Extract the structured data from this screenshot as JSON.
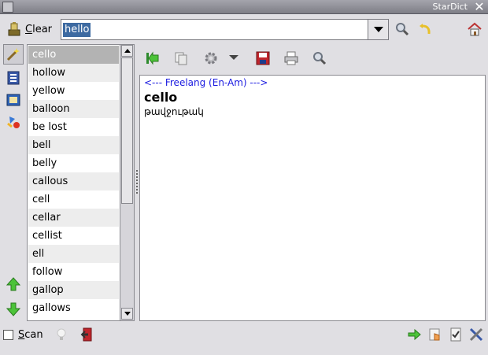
{
  "window": {
    "title": "StarDict"
  },
  "search": {
    "clear_label": "Clear",
    "query": "hello"
  },
  "wordlist": {
    "words": [
      "cello",
      "hollow",
      "yellow",
      "balloon",
      "be lost",
      "bell",
      "belly",
      "callous",
      "cell",
      "cellar",
      "cellist",
      "ell",
      "follow",
      "gallop",
      "gallows"
    ],
    "selected_index": 0
  },
  "definition": {
    "dict_header": "<--- Freelang (En-Am) --->",
    "headword": "cello",
    "translation": "թավջութակ"
  },
  "bottom": {
    "scan_label": "Scan",
    "scan_checked": false
  },
  "colors": {
    "selection": "#3d6aa1",
    "dict_header": "#1a1ae0",
    "list_selected": "#b3b3b3"
  }
}
